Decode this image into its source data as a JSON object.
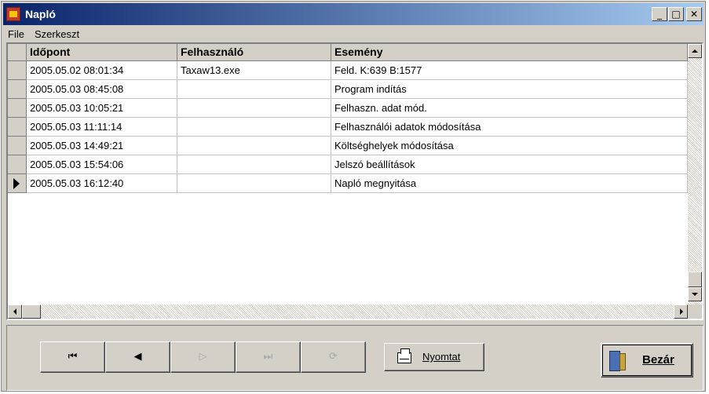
{
  "window": {
    "title": "Napló",
    "controls": {
      "minimize": "_",
      "maximize": "□",
      "close": "✕"
    }
  },
  "menu": [
    {
      "label": "File"
    },
    {
      "label": "Szerkeszt"
    }
  ],
  "table": {
    "columns": [
      "Időpont",
      "Felhasználó",
      "Esemény"
    ],
    "rows": [
      [
        "2005.05.02 08:01:34",
        "Taxaw13.exe",
        "Feld. K:639 B:1577"
      ],
      [
        "2005.05.03 08:45:08",
        "",
        "Program indítás"
      ],
      [
        "2005.05.03 10:05:21",
        "",
        "Felhaszn. adat mód."
      ],
      [
        "2005.05.03 11:11:14",
        "",
        "Felhasználói adatok módosítása"
      ],
      [
        "2005.05.03 14:49:21",
        "",
        "Költséghelyek módosítása"
      ],
      [
        "2005.05.03 15:54:06",
        "",
        "Jelszó beállítások"
      ],
      [
        "2005.05.03 16:12:40",
        "",
        "Napló megnyitása"
      ]
    ],
    "current_row_index": 6
  },
  "navigator": [
    {
      "name": "first-record-button",
      "glyph": "⏮",
      "enabled": true
    },
    {
      "name": "prior-record-button",
      "glyph": "◀",
      "enabled": true
    },
    {
      "name": "next-record-button",
      "glyph": "▷",
      "enabled": false
    },
    {
      "name": "last-record-button",
      "glyph": "⏭",
      "enabled": false
    },
    {
      "name": "refresh-button",
      "glyph": "⟳",
      "enabled": false
    }
  ],
  "buttons": {
    "print": "Nyomtat",
    "close": "Bezár"
  },
  "icons": {
    "app": "app-icon",
    "print": "printer-icon",
    "close": "door-exit-icon"
  }
}
